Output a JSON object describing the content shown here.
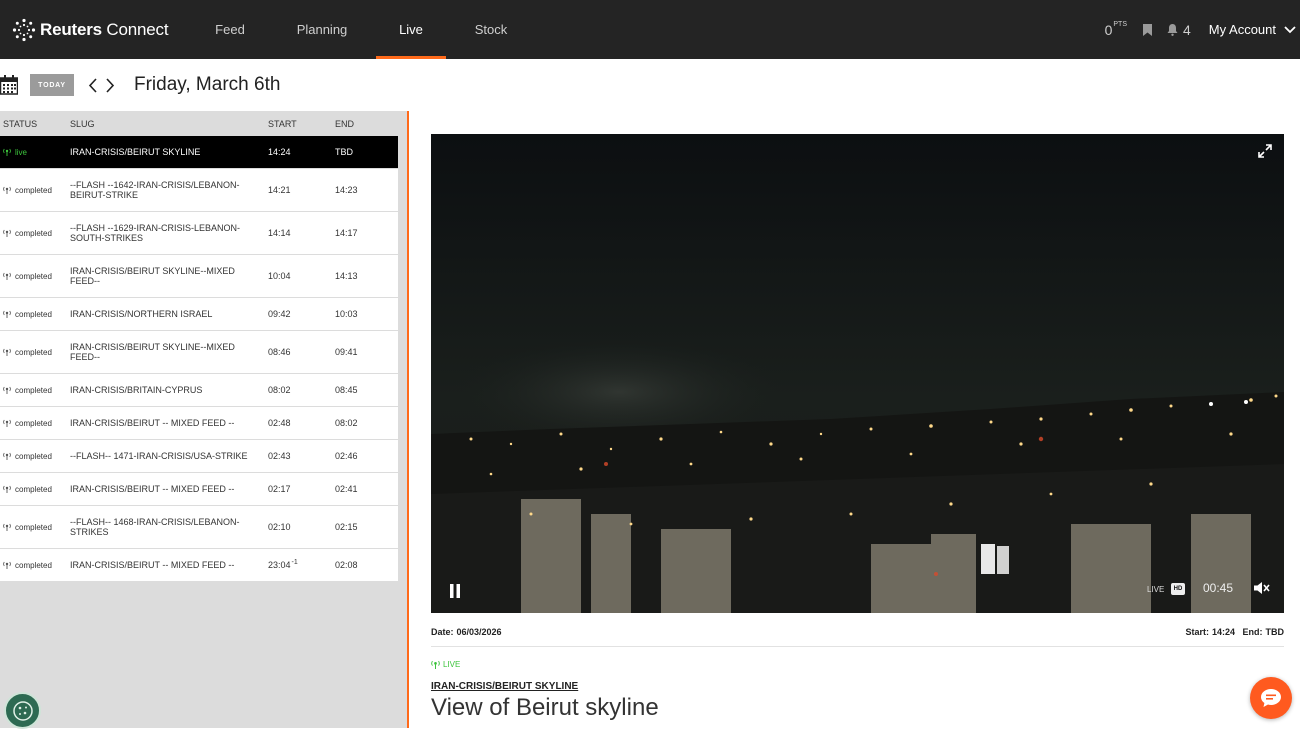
{
  "nav": {
    "brand_main": "Reuters",
    "brand_sub": " Connect",
    "tabs": [
      {
        "label": "Feed"
      },
      {
        "label": "Planning"
      },
      {
        "label": "Live"
      },
      {
        "label": "Stock"
      }
    ],
    "active_tab": "Live",
    "points": "0",
    "points_unit": "PTS",
    "notification_count": "4",
    "account_label": "My Account"
  },
  "datebar": {
    "today_label": "TODAY",
    "date": "Friday, March 6th"
  },
  "schedule": {
    "headers": {
      "status": "STATUS",
      "slug": "SLUG",
      "start": "START",
      "end": "END"
    },
    "rows": [
      {
        "status": "live",
        "slug": "IRAN-CRISIS/BEIRUT SKYLINE",
        "start": "14:24",
        "end": "TBD"
      },
      {
        "status": "completed",
        "slug": "--FLASH --1642-IRAN-CRISIS/LEBANON-BEIRUT-STRIKE",
        "start": "14:21",
        "end": "14:23"
      },
      {
        "status": "completed",
        "slug": "--FLASH --1629-IRAN-CRISIS-LEBANON-SOUTH-STRIKES",
        "start": "14:14",
        "end": "14:17"
      },
      {
        "status": "completed",
        "slug": "IRAN-CRISIS/BEIRUT SKYLINE--MIXED FEED--",
        "start": "10:04",
        "end": "14:13"
      },
      {
        "status": "completed",
        "slug": "IRAN-CRISIS/NORTHERN ISRAEL",
        "start": "09:42",
        "end": "10:03"
      },
      {
        "status": "completed",
        "slug": "IRAN-CRISIS/BEIRUT SKYLINE--MIXED FEED--",
        "start": "08:46",
        "end": "09:41"
      },
      {
        "status": "completed",
        "slug": "IRAN-CRISIS/BRITAIN-CYPRUS",
        "start": "08:02",
        "end": "08:45"
      },
      {
        "status": "completed",
        "slug": "IRAN-CRISIS/BEIRUT -- MIXED FEED --",
        "start": "02:48",
        "end": "08:02"
      },
      {
        "status": "completed",
        "slug": "--FLASH-- 1471-IRAN-CRISIS/USA-STRIKE",
        "start": "02:43",
        "end": "02:46"
      },
      {
        "status": "completed",
        "slug": "IRAN-CRISIS/BEIRUT -- MIXED FEED --",
        "start": "02:17",
        "end": "02:41"
      },
      {
        "status": "completed",
        "slug": "--FLASH-- 1468-IRAN-CRISIS/LEBANON-STRIKES",
        "start": "02:10",
        "end": "02:15"
      },
      {
        "status": "completed",
        "slug": "IRAN-CRISIS/BEIRUT -- MIXED FEED --",
        "start": "23:04",
        "start_sup": "-1",
        "end": "02:08"
      }
    ]
  },
  "player": {
    "live_label": "LIVE",
    "hd_label": "HD",
    "elapsed": "00:45"
  },
  "meta": {
    "date_label": "Date:",
    "date_value": "06/03/2026",
    "start_label": "Start:",
    "start_value": "14:24",
    "end_label": "End:",
    "end_value": "TBD"
  },
  "story": {
    "status": "LIVE",
    "slug": "IRAN-CRISIS/BEIRUT SKYLINE",
    "title": "View of Beirut skyline"
  },
  "colors": {
    "accent": "#ff6a1a",
    "live_green": "#3cc43c",
    "nav_bg": "#242424"
  }
}
